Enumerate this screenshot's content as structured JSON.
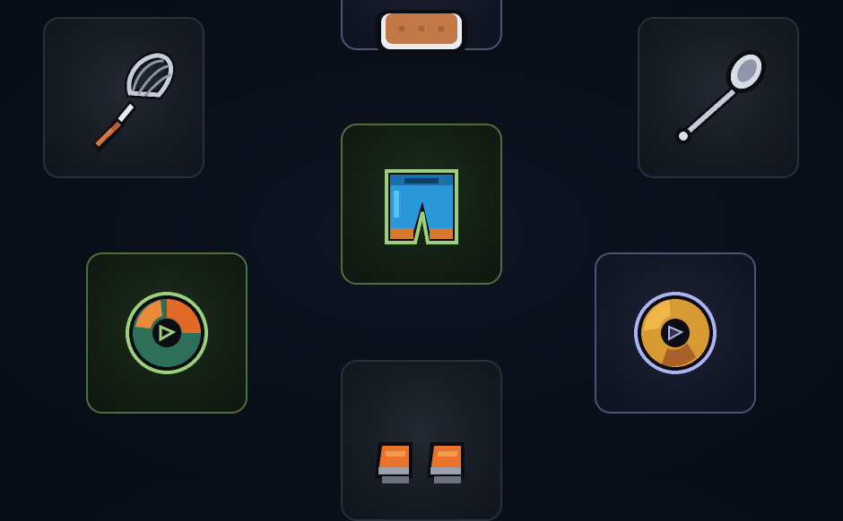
{
  "inventory": {
    "items": [
      {
        "id": "whisk",
        "icon": "whisk-icon",
        "rarity": "common"
      },
      {
        "id": "top-item",
        "icon": "bread-icon",
        "rarity": "rare"
      },
      {
        "id": "spoon",
        "icon": "spoon-icon",
        "rarity": "common"
      },
      {
        "id": "pants",
        "icon": "pants-icon",
        "rarity": "uncommon"
      },
      {
        "id": "ring-green",
        "icon": "ring-icon",
        "rarity": "uncommon"
      },
      {
        "id": "ring-blue",
        "icon": "ring-icon",
        "rarity": "rare"
      },
      {
        "id": "shoes",
        "icon": "shoes-icon",
        "rarity": "common"
      }
    ]
  },
  "colors": {
    "background": "#0a0f19",
    "common_border": "#2a2f38",
    "uncommon_border": "#4f6e3f",
    "rare_border": "#4b5478"
  }
}
